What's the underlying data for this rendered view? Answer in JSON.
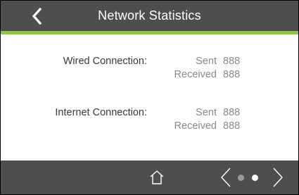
{
  "header": {
    "title": "Network Statistics",
    "back_icon": "chevron-left-icon",
    "bar_color": "#4e4e4e",
    "accent_color": "#8fc541"
  },
  "sections": [
    {
      "label": "Wired Connection:",
      "sent_label": "Sent",
      "sent_value": "888",
      "received_label": "Received",
      "received_value": "888"
    },
    {
      "label": "Internet Connection:",
      "sent_label": "Sent",
      "sent_value": "888",
      "received_label": "Received",
      "received_value": "888"
    }
  ],
  "footer": {
    "home_icon": "home-icon",
    "prev_icon": "chevron-left-icon",
    "next_icon": "chevron-right-icon",
    "pagination": {
      "total": 2,
      "active": 2
    }
  }
}
